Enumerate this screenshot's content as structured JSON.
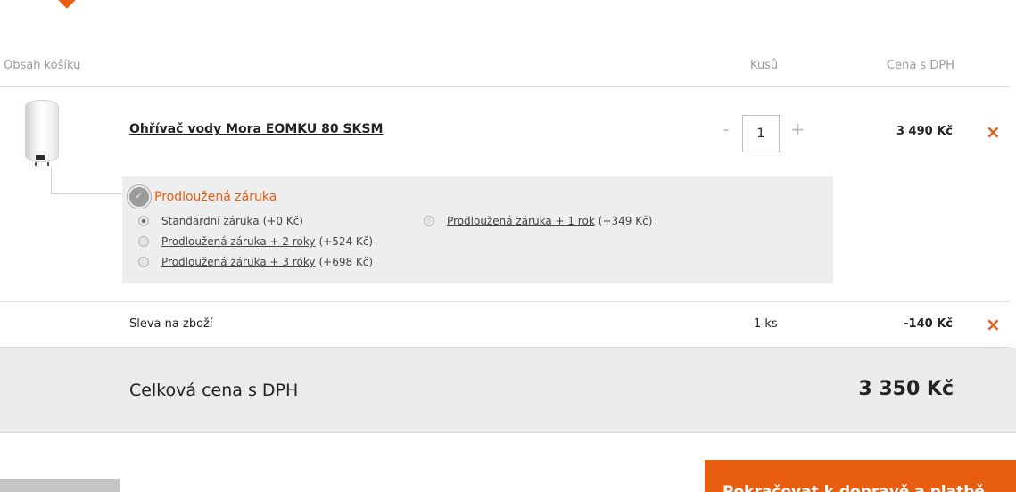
{
  "header": {
    "content_label": "Obsah košíku",
    "qty_label": "Kusů",
    "price_label": "Cena s DPH"
  },
  "product": {
    "name": "Ohřívač vody Mora EOMKU 80 SKSM",
    "qty_minus": "-",
    "quantity": "1",
    "qty_plus": "+",
    "price": "3 490 Kč",
    "remove_icon": "×"
  },
  "warranty": {
    "title": "Prodloužená záruka",
    "options": [
      {
        "label": "Standardní záruka",
        "extra": "(+0 Kč)",
        "selected": true
      },
      {
        "label": "Prodloužená záruka + 1 rok",
        "extra": "(+349 Kč)",
        "selected": false
      },
      {
        "label": "Prodloužená záruka + 2 roky",
        "extra": "(+524 Kč)",
        "selected": false
      },
      {
        "label": "Prodloužená záruka + 3 roky",
        "extra": "(+698 Kč)",
        "selected": false
      }
    ]
  },
  "discount": {
    "label": "Sleva na zboží",
    "qty": "1 ks",
    "price": "-140 Kč",
    "remove_icon": "×"
  },
  "total": {
    "label": "Celková cena s DPH",
    "value": "3 350 Kč"
  },
  "cta": {
    "label": "Pokračovat k dopravě a platbě"
  },
  "colors": {
    "accent": "#e85d0f",
    "total_bg": "#ebebeb",
    "warranty_bg": "#eeeeee"
  }
}
